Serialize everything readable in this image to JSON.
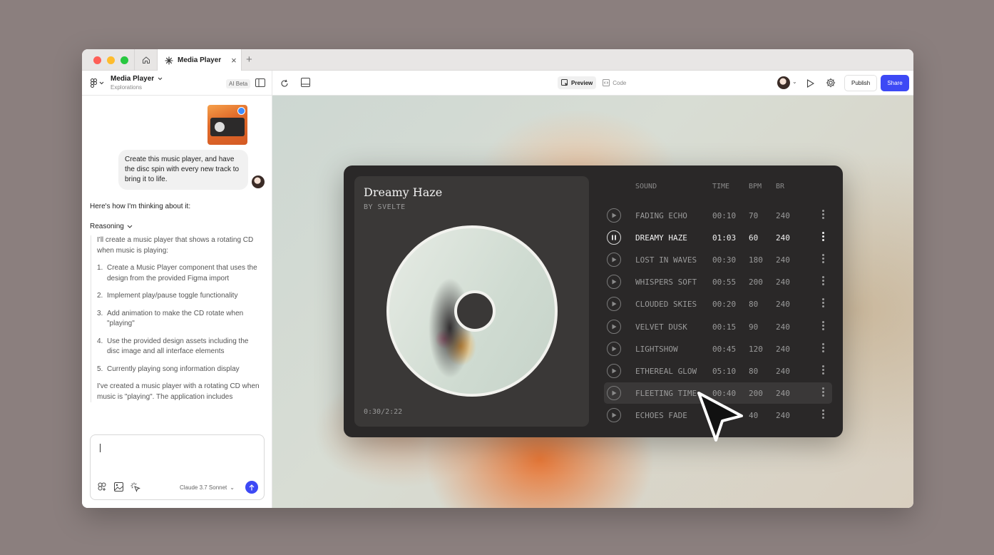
{
  "browser": {
    "tab_label": "Media Player",
    "new_tab_symbol": "+"
  },
  "toolbar": {
    "project_name": "Media Player",
    "project_sub": "Explorations",
    "ai_beta": "AI Beta",
    "preview_label": "Preview",
    "code_label": "Code",
    "publish_label": "Publish",
    "share_label": "Share",
    "accent": "#3d49f5"
  },
  "chat": {
    "user_message": "Create this music player, and have the disc spin with every new track to bring it to life.",
    "thinking_intro": "Here's how I'm thinking about it:",
    "reasoning_label": "Reasoning",
    "reasoning_intro": "I'll create a music player that shows a rotating CD when music is playing:",
    "steps": [
      {
        "num": "1.",
        "text": "Create a Music Player component that uses the design from the provided Figma import"
      },
      {
        "num": "2.",
        "text": "Implement play/pause toggle functionality"
      },
      {
        "num": "3.",
        "text": "Add animation to make the CD rotate when \"playing\""
      },
      {
        "num": "4.",
        "text": "Use the provided design assets including the disc image and all interface elements"
      },
      {
        "num": "5.",
        "text": "Currently playing song information display"
      }
    ],
    "summary": "I've created a music player with a rotating CD when music is \"playing\". The application includes",
    "model_label": "Claude 3.7 Sonnet"
  },
  "player": {
    "title": "Dreamy Haze",
    "artist": "BY SVELTE",
    "position": "0:30/2:22",
    "headers": {
      "sound": "SOUND",
      "time": "TIME",
      "bpm": "BPM",
      "br": "BR"
    },
    "tracks": [
      {
        "name": "FADING ECHO",
        "time": "00:10",
        "bpm": "70",
        "br": "240",
        "state": "idle"
      },
      {
        "name": "DREAMY HAZE",
        "time": "01:03",
        "bpm": "60",
        "br": "240",
        "state": "playing"
      },
      {
        "name": "LOST IN WAVES",
        "time": "00:30",
        "bpm": "180",
        "br": "240",
        "state": "idle"
      },
      {
        "name": "WHISPERS SOFT",
        "time": "00:55",
        "bpm": "200",
        "br": "240",
        "state": "idle"
      },
      {
        "name": "CLOUDED SKIES",
        "time": "00:20",
        "bpm": "80",
        "br": "240",
        "state": "idle"
      },
      {
        "name": "VELVET DUSK",
        "time": "00:15",
        "bpm": "90",
        "br": "240",
        "state": "idle"
      },
      {
        "name": "LIGHTSHOW",
        "time": "00:45",
        "bpm": "120",
        "br": "240",
        "state": "idle"
      },
      {
        "name": "ETHEREAL GLOW",
        "time": "05:10",
        "bpm": "80",
        "br": "240",
        "state": "idle"
      },
      {
        "name": "FLEETING TIME",
        "time": "00:40",
        "bpm": "200",
        "br": "240",
        "state": "hover"
      },
      {
        "name": "ECHOES FADE",
        "time": "",
        "bpm": "40",
        "br": "240",
        "state": "idle"
      }
    ]
  }
}
